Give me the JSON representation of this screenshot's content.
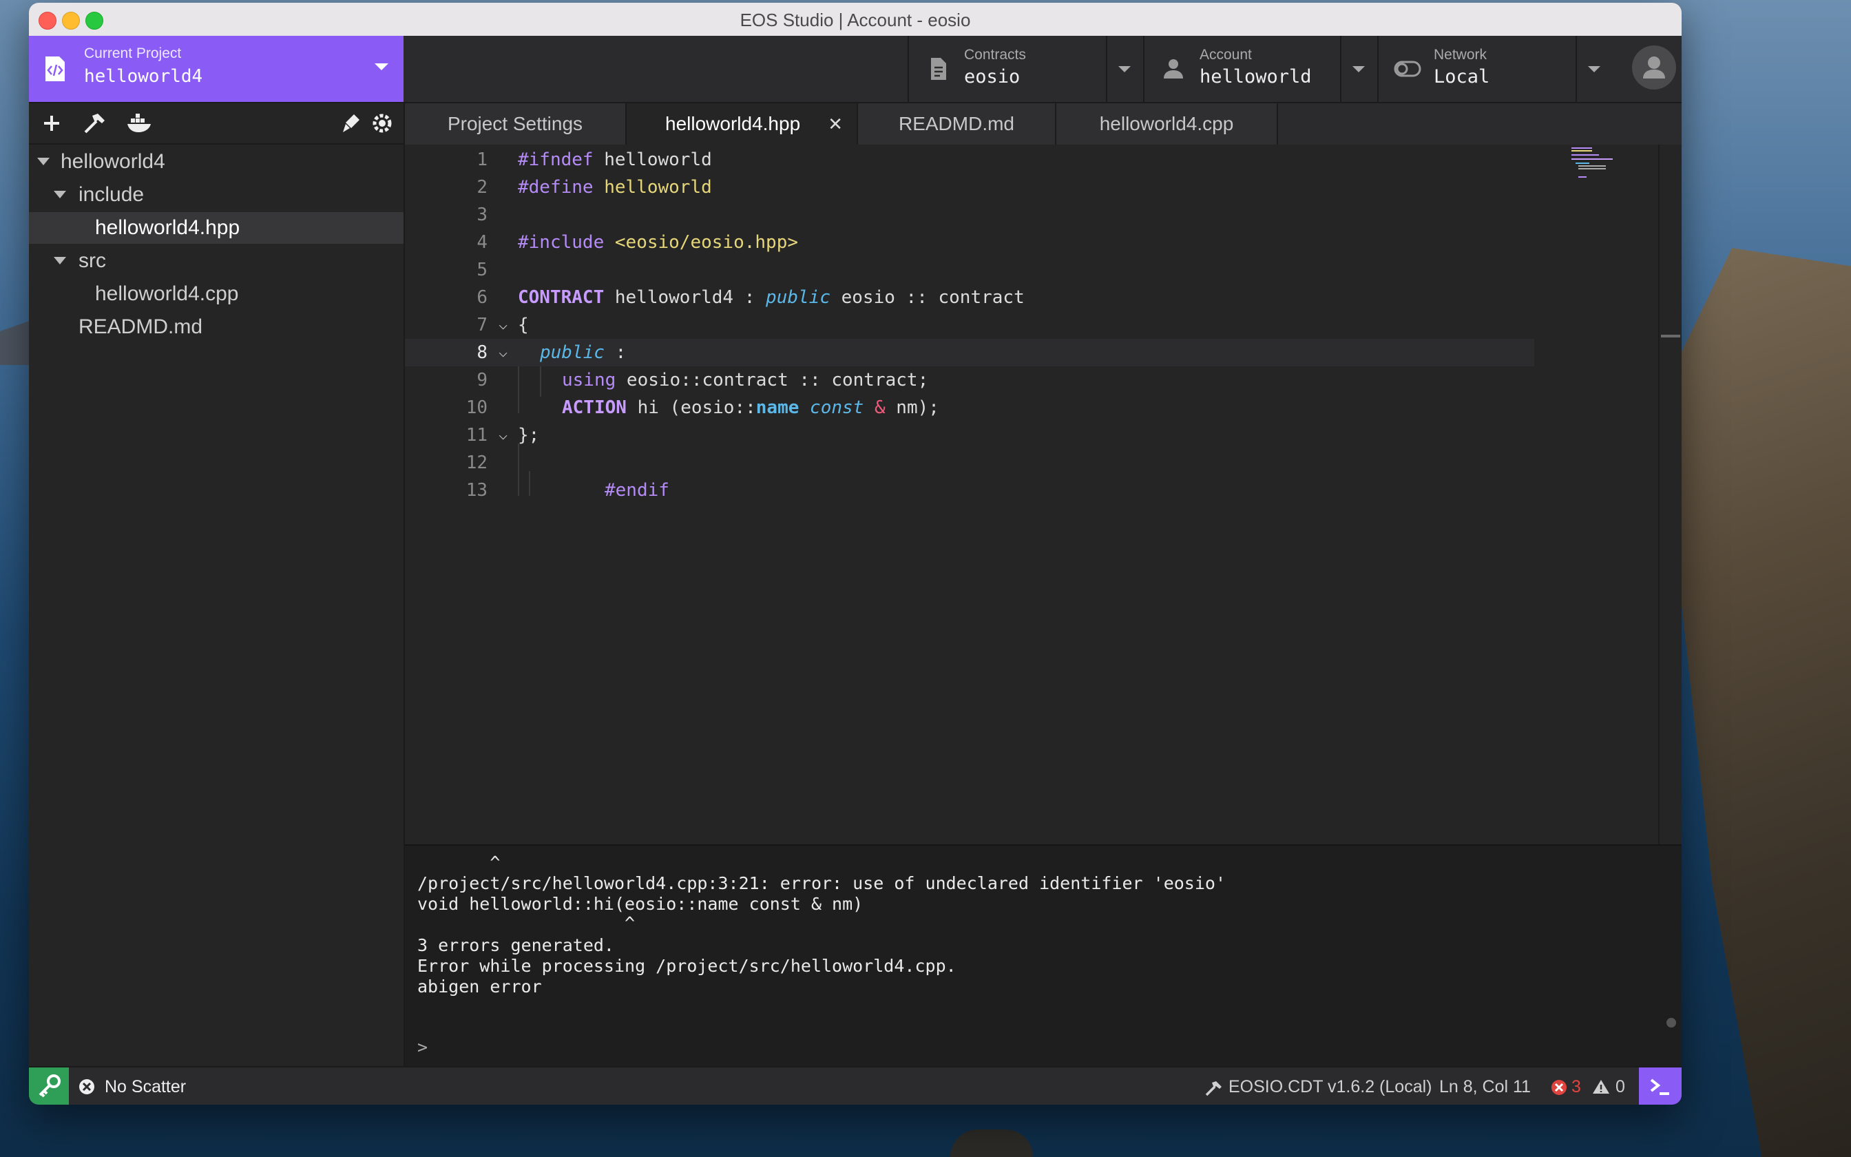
{
  "window": {
    "title": "EOS Studio | Account - eosio"
  },
  "header": {
    "project": {
      "label": "Current Project",
      "value": "helloworld4"
    },
    "contracts": {
      "label": "Contracts",
      "value": "eosio"
    },
    "account": {
      "label": "Account",
      "value": "helloworld"
    },
    "network": {
      "label": "Network",
      "value": "Local"
    }
  },
  "sidebar": {
    "tree": [
      {
        "label": "helloworld4"
      },
      {
        "label": "include"
      },
      {
        "label": "helloworld4.hpp"
      },
      {
        "label": "src"
      },
      {
        "label": "helloworld4.cpp"
      },
      {
        "label": "READMD.md"
      }
    ]
  },
  "tabs": [
    {
      "label": "Project Settings"
    },
    {
      "label": "helloworld4.hpp"
    },
    {
      "label": "READMD.md"
    },
    {
      "label": "helloworld4.cpp"
    }
  ],
  "editor": {
    "current_line": 8,
    "lines": [
      {
        "n": "1",
        "t": [
          "#ifndef",
          " helloworld"
        ]
      },
      {
        "n": "2",
        "t": [
          "#define",
          " helloworld"
        ]
      },
      {
        "n": "3",
        "t": [
          ""
        ]
      },
      {
        "n": "4",
        "t": [
          "#include",
          " ",
          "<eosio/eosio.hpp>"
        ]
      },
      {
        "n": "5",
        "t": [
          ""
        ]
      },
      {
        "n": "6",
        "t": [
          "CONTRACT",
          " helloworld4 : ",
          "public",
          " eosio :: contract"
        ]
      },
      {
        "n": "7",
        "t": [
          "{"
        ]
      },
      {
        "n": "8",
        "t": [
          "public",
          " :"
        ]
      },
      {
        "n": "9",
        "t": [
          "using",
          " eosio::contract :: contract;"
        ]
      },
      {
        "n": "10",
        "t": [
          "ACTION",
          " hi (eosio::",
          "name",
          " ",
          "const",
          " ",
          "&",
          " nm);"
        ]
      },
      {
        "n": "11",
        "t": [
          "};"
        ]
      },
      {
        "n": "12",
        "t": [
          ""
        ]
      },
      {
        "n": "13",
        "t": [
          "#endif"
        ]
      }
    ]
  },
  "terminal": {
    "lines": [
      "       ^",
      "/project/src/helloworld4.cpp:3:21: error: use of undeclared identifier 'eosio'",
      "void helloworld::hi(eosio::name const & nm)",
      "                    ^",
      "3 errors generated.",
      "Error while processing /project/src/helloworld4.cpp.",
      "abigen error"
    ],
    "prompt": ">"
  },
  "status": {
    "scatter": "No Scatter",
    "compiler": "EOSIO.CDT v1.6.2 (Local)",
    "cursor": "Ln 8, Col 11",
    "errors": "3",
    "warnings": "0"
  },
  "colors": {
    "accent": "#8a5cf5",
    "success": "#2f9e57",
    "error": "#e0443e"
  }
}
